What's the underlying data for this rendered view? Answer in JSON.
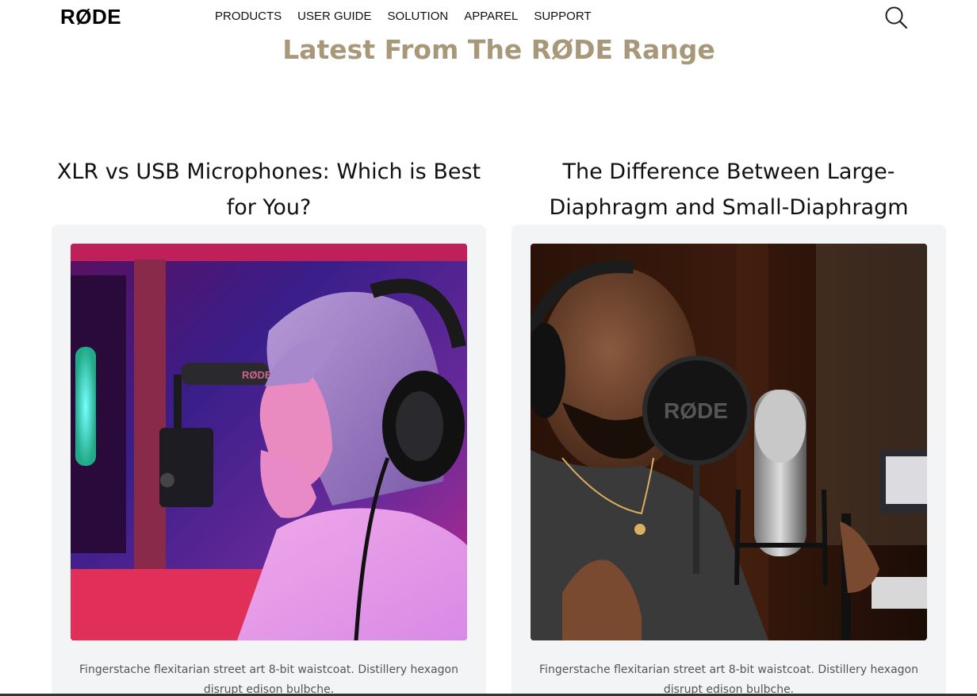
{
  "nav": {
    "logo": "RØDE",
    "links": [
      "PRODUCTS",
      "USER GUIDE",
      "SOLUTION",
      "APPAREL",
      "SUPPORT"
    ],
    "search_icon": "search-icon"
  },
  "section": {
    "title": "Latest From The RØDE Range"
  },
  "cards": [
    {
      "title": "XLR vs USB Microphones: Which is Best for You?",
      "image_label": "RØDE",
      "text": "Fingerstache flexitarian street art 8-bit waistcoat. Distillery hexagon disrupt edison bulbche."
    },
    {
      "title": "The Difference Between Large-Diaphragm and Small-Diaphragm",
      "image_label": "RØDE",
      "text": "Fingerstache flexitarian street art 8-bit waistcoat. Distillery hexagon disrupt edison bulbche."
    }
  ],
  "colors": {
    "accent_gold": "#a8987a",
    "card_bg": "#f3f4f6"
  }
}
